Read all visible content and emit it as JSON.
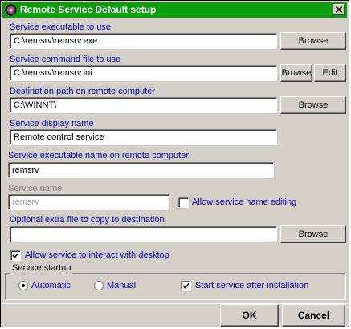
{
  "window": {
    "title": "Remote Service Default setup",
    "icon": "gear-icon",
    "close": "close-icon"
  },
  "colors": {
    "titlebar": "#0a9d0a",
    "label_blue": "#0000cc",
    "face": "#d4d0c8"
  },
  "exe": {
    "label": "Service executable to use",
    "value": "C:\\remsrv\\remsrv.exe",
    "browse": "Browse"
  },
  "cmd": {
    "label": "Service command file to use",
    "value": "C:\\remsrv\\remsrv.ini",
    "browse": "Browse",
    "edit": "Edit"
  },
  "dest": {
    "label": "Destination path on remote computer",
    "value": "C:\\WINNT\\",
    "browse": "Browse"
  },
  "display": {
    "label": "Service display name",
    "value": "Remote control service"
  },
  "remote_exe": {
    "label": "Service executable name on remote computer",
    "value": "remsrv"
  },
  "svcname": {
    "label": "Service name",
    "value": "remsrv",
    "allow_edit": "Allow service name editing",
    "allow_edit_checked": false
  },
  "extra": {
    "label": "Optional extra file to copy to destination",
    "value": "",
    "browse": "Browse"
  },
  "interact": {
    "label": "Allow service to interact with desktop",
    "checked": true
  },
  "startup": {
    "group_label": "Service startup",
    "automatic": "Automatic",
    "manual": "Manual",
    "selected": "Automatic",
    "start_after": "Start service after installation",
    "start_after_checked": true
  },
  "footer": {
    "ok": "OK",
    "cancel": "Cancel"
  }
}
